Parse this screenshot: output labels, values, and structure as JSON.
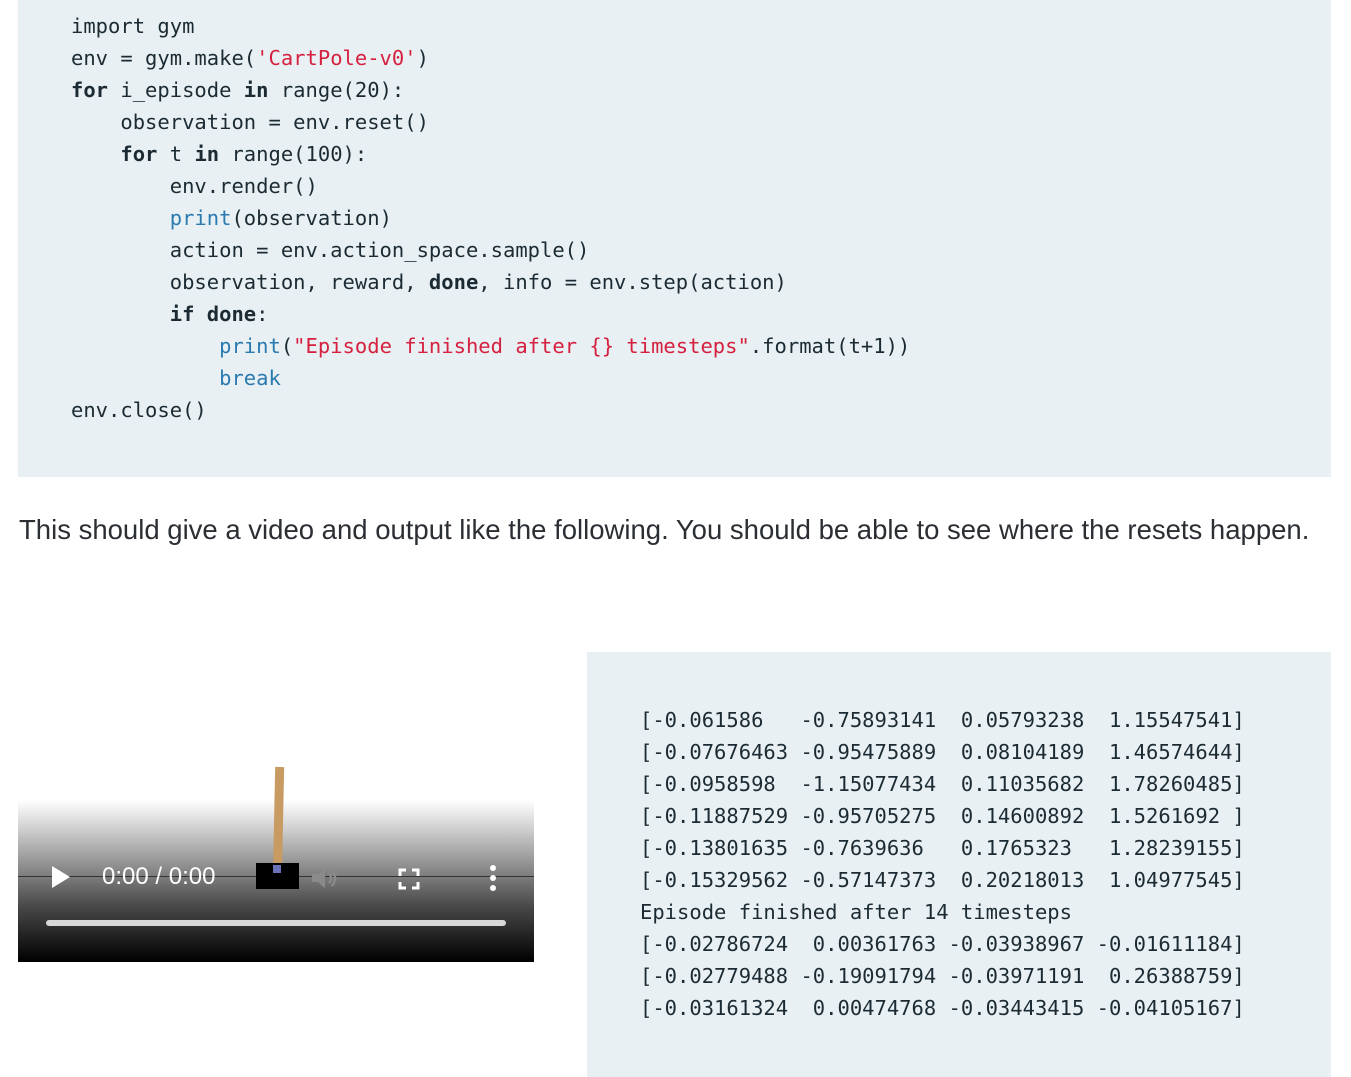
{
  "code": {
    "lines": [
      [
        {
          "t": "import gym",
          "c": ""
        }
      ],
      [
        {
          "t": "env = gym.make(",
          "c": ""
        },
        {
          "t": "'CartPole-v0'",
          "c": "str"
        },
        {
          "t": ")",
          "c": ""
        }
      ],
      [
        {
          "t": "for",
          "c": "kw"
        },
        {
          "t": " i_episode ",
          "c": ""
        },
        {
          "t": "in",
          "c": "kw"
        },
        {
          "t": " range(20):",
          "c": ""
        }
      ],
      [
        {
          "t": "    observation = env.reset()",
          "c": ""
        }
      ],
      [
        {
          "t": "    ",
          "c": ""
        },
        {
          "t": "for",
          "c": "kw"
        },
        {
          "t": " t ",
          "c": ""
        },
        {
          "t": "in",
          "c": "kw"
        },
        {
          "t": " range(100):",
          "c": ""
        }
      ],
      [
        {
          "t": "        env.render()",
          "c": ""
        }
      ],
      [
        {
          "t": "        ",
          "c": ""
        },
        {
          "t": "print",
          "c": "fn"
        },
        {
          "t": "(observation)",
          "c": ""
        }
      ],
      [
        {
          "t": "        action = env.action_space.sample()",
          "c": ""
        }
      ],
      [
        {
          "t": "        observation, reward, ",
          "c": ""
        },
        {
          "t": "done",
          "c": "kw"
        },
        {
          "t": ", info = env.step(action)",
          "c": ""
        }
      ],
      [
        {
          "t": "        ",
          "c": ""
        },
        {
          "t": "if",
          "c": "kw"
        },
        {
          "t": " ",
          "c": ""
        },
        {
          "t": "done",
          "c": "kw"
        },
        {
          "t": ":",
          "c": ""
        }
      ],
      [
        {
          "t": "            ",
          "c": ""
        },
        {
          "t": "print",
          "c": "fn"
        },
        {
          "t": "(",
          "c": ""
        },
        {
          "t": "\"Episode finished after {} timesteps\"",
          "c": "str"
        },
        {
          "t": ".format(t+1))",
          "c": ""
        }
      ],
      [
        {
          "t": "            ",
          "c": ""
        },
        {
          "t": "break",
          "c": "fn"
        }
      ],
      [
        {
          "t": "env.close()",
          "c": ""
        }
      ]
    ]
  },
  "paragraph": "This should give a video and output like the following. You should be able to see where the resets happen.",
  "video": {
    "time": "0:00 / 0:00",
    "play_icon": "play-icon",
    "volume_icon": "volume-icon",
    "fullscreen_icon": "fullscreen-icon",
    "more_icon": "more-options-icon"
  },
  "output": {
    "lines": [
      "[-0.061586   -0.75893141  0.05793238  1.15547541]",
      "[-0.07676463 -0.95475889  0.08104189  1.46574644]",
      "[-0.0958598  -1.15077434  0.11035682  1.78260485]",
      "[-0.11887529 -0.95705275  0.14600892  1.5261692 ]",
      "[-0.13801635 -0.7639636   0.1765323   1.28239155]",
      "[-0.15329562 -0.57147373  0.20218013  1.04977545]",
      "Episode finished after 14 timesteps",
      "[-0.02786724  0.00361763 -0.03938967 -0.01611184]",
      "[-0.02779488 -0.19091794 -0.03971191  0.26388759]",
      "[-0.03161324  0.00474768 -0.03443415 -0.04105167]"
    ]
  }
}
